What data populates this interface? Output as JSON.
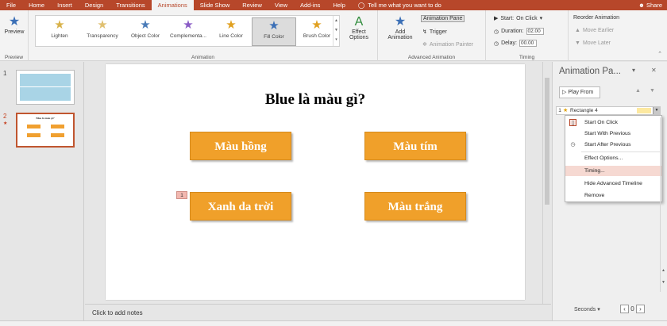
{
  "menu": {
    "tabs": [
      "File",
      "Home",
      "Insert",
      "Design",
      "Transitions",
      "Animations",
      "Slide Show",
      "Review",
      "View",
      "Add-ins",
      "Help"
    ],
    "active_index": 5,
    "tell_me": "Tell me what you want to do",
    "share": "Share"
  },
  "ribbon": {
    "preview": {
      "label": "Preview",
      "group": "Preview"
    },
    "animation_group": "Animation",
    "animations": [
      {
        "name": "Lighten",
        "color": "#d8b24a"
      },
      {
        "name": "Transparency",
        "color": "#e0c070"
      },
      {
        "name": "Object Color",
        "color": "#4a7bb8"
      },
      {
        "name": "Complementa...",
        "color": "#8a5cc6"
      },
      {
        "name": "Line Color",
        "color": "#e0a020"
      },
      {
        "name": "Fill Color",
        "color": "#3b6fb6"
      },
      {
        "name": "Brush Color",
        "color": "#e0a020"
      }
    ],
    "selected_animation": 5,
    "effect_options": "Effect Options",
    "add_animation": "Add Animation",
    "animation_pane": "Animation Pane",
    "trigger": "Trigger",
    "animation_painter": "Animation Painter",
    "advanced_group": "Advanced Animation",
    "start_label": "Start:",
    "start_value": "On Click",
    "duration_label": "Duration:",
    "duration_value": "02.00",
    "delay_label": "Delay:",
    "delay_value": "00.00",
    "timing_group": "Timing",
    "reorder": "Reorder Animation",
    "move_earlier": "Move Earlier",
    "move_later": "Move Later"
  },
  "thumbnails": {
    "numbers": [
      "1",
      "2"
    ],
    "slide2_title": "Blue là màu gì?"
  },
  "slide": {
    "title": "Blue là màu gì?",
    "answers": [
      "Màu hồng",
      "Màu tím",
      "Xanh da trời",
      "Màu trắng"
    ],
    "answer_color": "#f0a02a",
    "anim_tag": "1"
  },
  "notes": {
    "placeholder": "Click to add notes"
  },
  "pane": {
    "title": "Animation Pa...",
    "play_from": "Play From",
    "entry": {
      "number": "1",
      "label": "Rectangle 4"
    },
    "context_menu": [
      "Start On Click",
      "Start With Previous",
      "Start After Previous",
      "Effect Options...",
      "Timing...",
      "Hide Advanced Timeline",
      "Remove"
    ],
    "highlighted_index": 4,
    "seconds": "Seconds",
    "zoom_value": "0"
  },
  "colors": {
    "accent": "#b7472a",
    "button_orange": "#f0a02a"
  }
}
